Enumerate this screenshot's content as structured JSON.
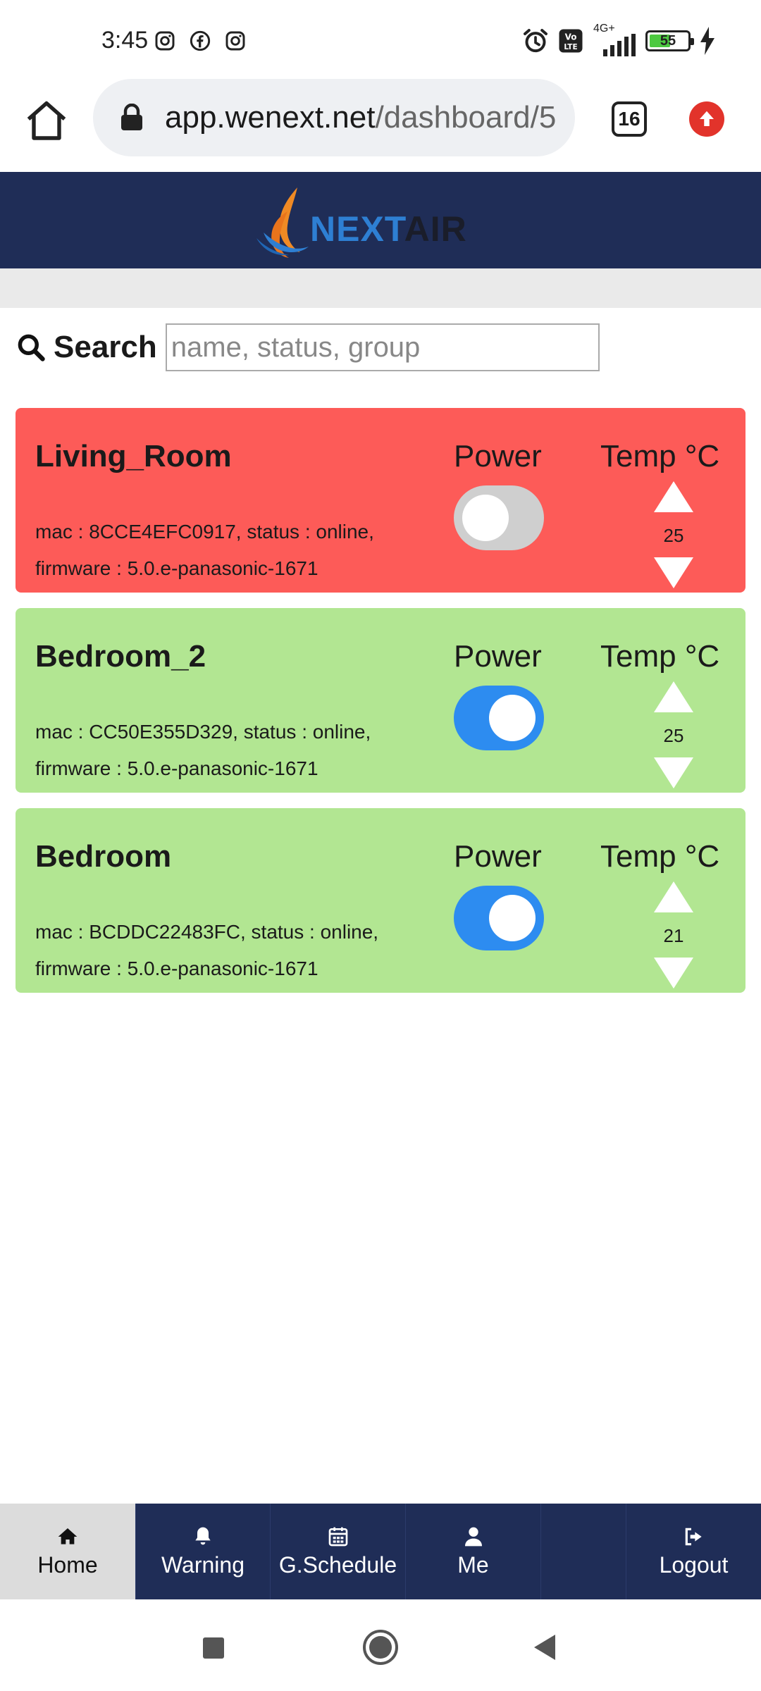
{
  "status_bar": {
    "time": "3:45",
    "network": "4G+",
    "battery": "55",
    "battery_level_percent": 55,
    "icons": [
      "instagram-icon",
      "facebook-icon",
      "instagram-icon",
      "alarm-icon",
      "volte-icon",
      "signal-icon",
      "battery-icon",
      "charging-icon"
    ]
  },
  "browser": {
    "url_host": "app.wenext.net",
    "url_path": "/dashboard/5",
    "tab_count": "16"
  },
  "brand": {
    "logo_next": "NEXT",
    "logo_air": "AIR",
    "header_color": "#1f2d57"
  },
  "search": {
    "label": "Search",
    "placeholder": "name, status, group",
    "value": ""
  },
  "labels": {
    "power": "Power",
    "temp": "Temp °C"
  },
  "devices": [
    {
      "name": "Living_Room",
      "info_line1": "mac : 8CCE4EFC0917, status : online,",
      "info_line2": "firmware : 5.0.e-panasonic-1671",
      "power_on": false,
      "temp": "25",
      "color": "#fd5b58"
    },
    {
      "name": "Bedroom_2",
      "info_line1": "mac : CC50E355D329, status : online,",
      "info_line2": "firmware : 5.0.e-panasonic-1671",
      "power_on": true,
      "temp": "25",
      "color": "#b2e692"
    },
    {
      "name": "Bedroom",
      "info_line1": "mac : BCDDC22483FC, status : online,",
      "info_line2": "firmware : 5.0.e-panasonic-1671",
      "power_on": true,
      "temp": "21",
      "color": "#b2e692"
    }
  ],
  "bottom_nav": {
    "home": "Home",
    "warning": "Warning",
    "schedule": "G.Schedule",
    "me": "Me",
    "logout": "Logout",
    "active": "Home"
  }
}
